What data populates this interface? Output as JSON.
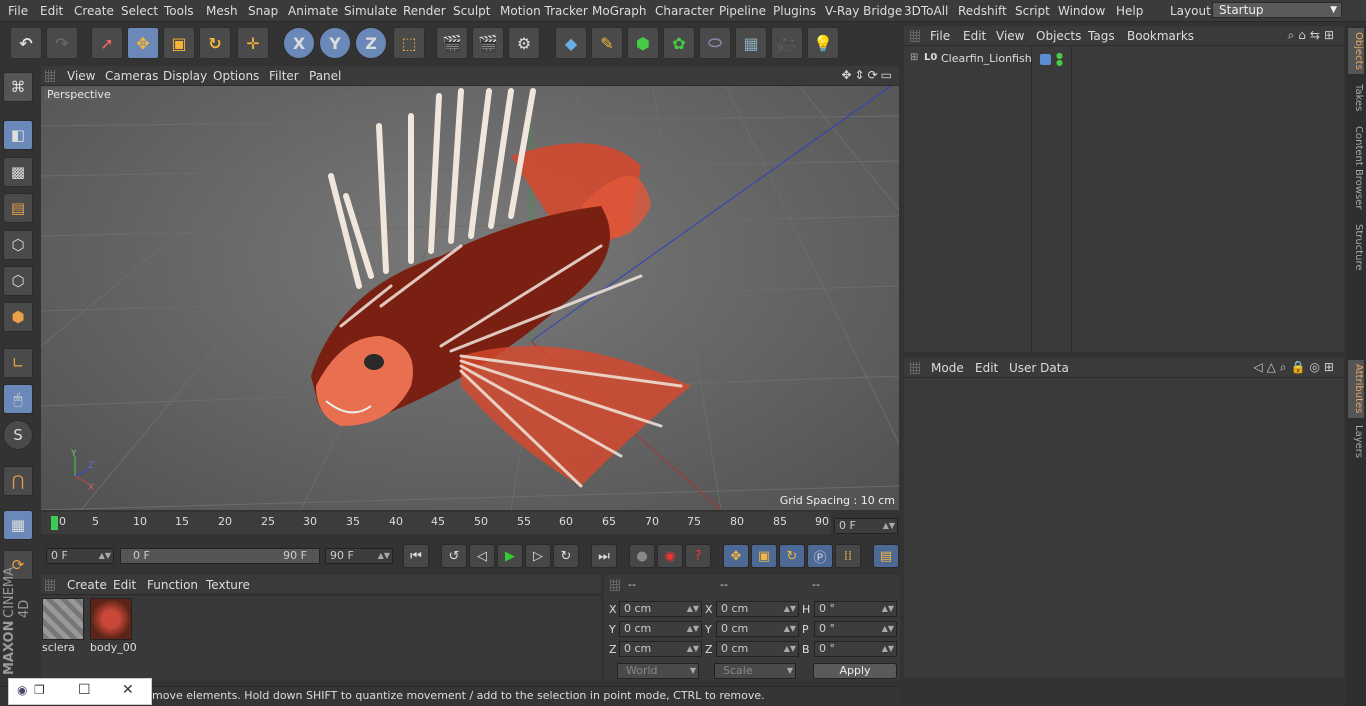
{
  "menu": [
    "File",
    "Edit",
    "Create",
    "Select",
    "Tools",
    "Mesh",
    "Snap",
    "Animate",
    "Simulate",
    "Render",
    "Sculpt",
    "Motion Tracker",
    "MoGraph",
    "Character",
    "Pipeline",
    "Plugins",
    "V-Ray Bridge",
    "3DToAll",
    "Redshift",
    "Script",
    "Window",
    "Help"
  ],
  "layout": {
    "label": "Layout:",
    "value": "Startup"
  },
  "toolbar": {
    "x": "X",
    "y": "Y",
    "z": "Z"
  },
  "viewport": {
    "menu": [
      "View",
      "Cameras",
      "Display",
      "Options",
      "Filter",
      "Panel"
    ],
    "label": "Perspective",
    "grid_spacing": "Grid Spacing : 10 cm",
    "axis": {
      "x": "X",
      "y": "Y",
      "z": "Z"
    }
  },
  "timeline": {
    "ticks": [
      "0",
      "5",
      "10",
      "15",
      "20",
      "25",
      "30",
      "35",
      "40",
      "45",
      "50",
      "55",
      "60",
      "65",
      "70",
      "75",
      "80",
      "85",
      "90"
    ],
    "current_frame": "0 F",
    "start_field": "0 F",
    "range_start": "0 F",
    "range_end": "90 F",
    "end_field": "90 F"
  },
  "objects": {
    "menu": [
      "File",
      "Edit",
      "View",
      "Objects",
      "Tags",
      "Bookmarks"
    ],
    "items": [
      {
        "name": "Clearfin_Lionfish",
        "badge": "L0"
      }
    ]
  },
  "attributes": {
    "menu": [
      "Mode",
      "Edit",
      "User Data"
    ]
  },
  "sidetabs": [
    "Objects",
    "Takes",
    "Content Browser",
    "Structure",
    "Attributes",
    "Layers"
  ],
  "materials": {
    "menu": [
      "Create",
      "Edit",
      "Function",
      "Texture"
    ],
    "items": [
      {
        "name": "sclera"
      },
      {
        "name": "body_00"
      }
    ]
  },
  "coords": {
    "headers": [
      "--",
      "--",
      "--"
    ],
    "rows": [
      {
        "a": "X",
        "av": "0 cm",
        "b": "X",
        "bv": "0 cm",
        "c": "H",
        "cv": "0 °"
      },
      {
        "a": "Y",
        "av": "0 cm",
        "b": "Y",
        "bv": "0 cm",
        "c": "P",
        "cv": "0 °"
      },
      {
        "a": "Z",
        "av": "0 cm",
        "b": "Z",
        "bv": "0 cm",
        "c": "B",
        "cv": "0 °"
      }
    ],
    "world": "World",
    "scale": "Scale",
    "apply": "Apply"
  },
  "status": "move elements. Hold down SHIFT to quantize movement / add to the selection in point mode, CTRL to remove.",
  "brand": [
    "MAXON",
    "CINEMA 4D"
  ],
  "colors": {
    "accent": "#6a89b8",
    "fish_red": "#d9482c",
    "stripe": "#f1e6dc"
  }
}
